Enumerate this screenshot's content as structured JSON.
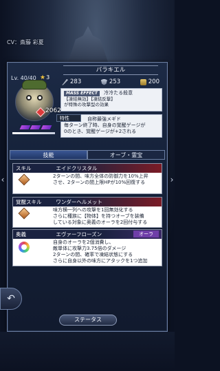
{
  "header": {
    "cv": "CV：斎藤 彩夏"
  },
  "character": {
    "name": "バラキエル",
    "level": "Lv. 40/40",
    "stars": "3",
    "power": "2062"
  },
  "stats": {
    "atk": "283",
    "def": "253",
    "hp": "200"
  },
  "mass_effect": {
    "tag": "MASS EFFECT",
    "name": "冷冷たる殺意",
    "line1": "【凍結無効】【凍結反撃】",
    "line2": "が特殊の攻撃型の効果"
  },
  "tokusei": {
    "label": "特性",
    "title": "自称最強メギド",
    "desc1": "毎ターン終了時、自身の覚醒ゲージが",
    "desc2": "0のとき、覚醒ゲージが+2される"
  },
  "tabs": {
    "skills": "技能",
    "orb": "オーブ・霊宝"
  },
  "skill": {
    "label": "スキル",
    "name": "エイドクリスタル",
    "line1": "2ターンの間、味方全体の防御力を10%上昇",
    "line2": "させ、2ターンの間上限HPが10%回復する"
  },
  "awaken": {
    "label": "覚醒スキル",
    "name": "ワンダーヘルメット",
    "line1": "味方横一列への攻撃を1回無効化する",
    "line2": "さらに種族に【物体】を持つオーブを装備",
    "line3": "している対象に奥義のオーラを2回付与する"
  },
  "ougi": {
    "label": "奥義",
    "name": "エヴァーフローズン",
    "tag": "オーラ",
    "line1": "自身のオーラを2個消費し、",
    "line2": "敵単体に攻撃力3.75倍のダメージ",
    "line3": "2ターンの間、確率で凍結状態にする",
    "line4": "さらに自身以外の味方にアタックを1つ追加"
  },
  "buttons": {
    "status": "ステータス",
    "back": "↶"
  }
}
